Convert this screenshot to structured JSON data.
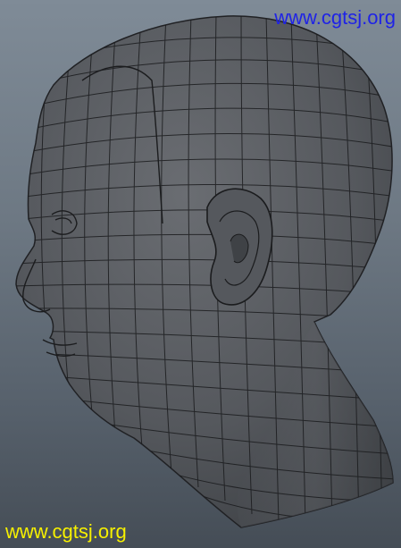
{
  "watermarks": {
    "top_right": "www.cgtsj.org",
    "bottom_left": "www.cgtsj.org"
  },
  "colors": {
    "watermark_top": "#1f23e6",
    "watermark_bottom": "#f6f000",
    "mesh_surface": "#5b5e62",
    "wire_lines": "#1b1c1e",
    "background_top": "#7f8b97",
    "background_bottom": "#454d56"
  }
}
